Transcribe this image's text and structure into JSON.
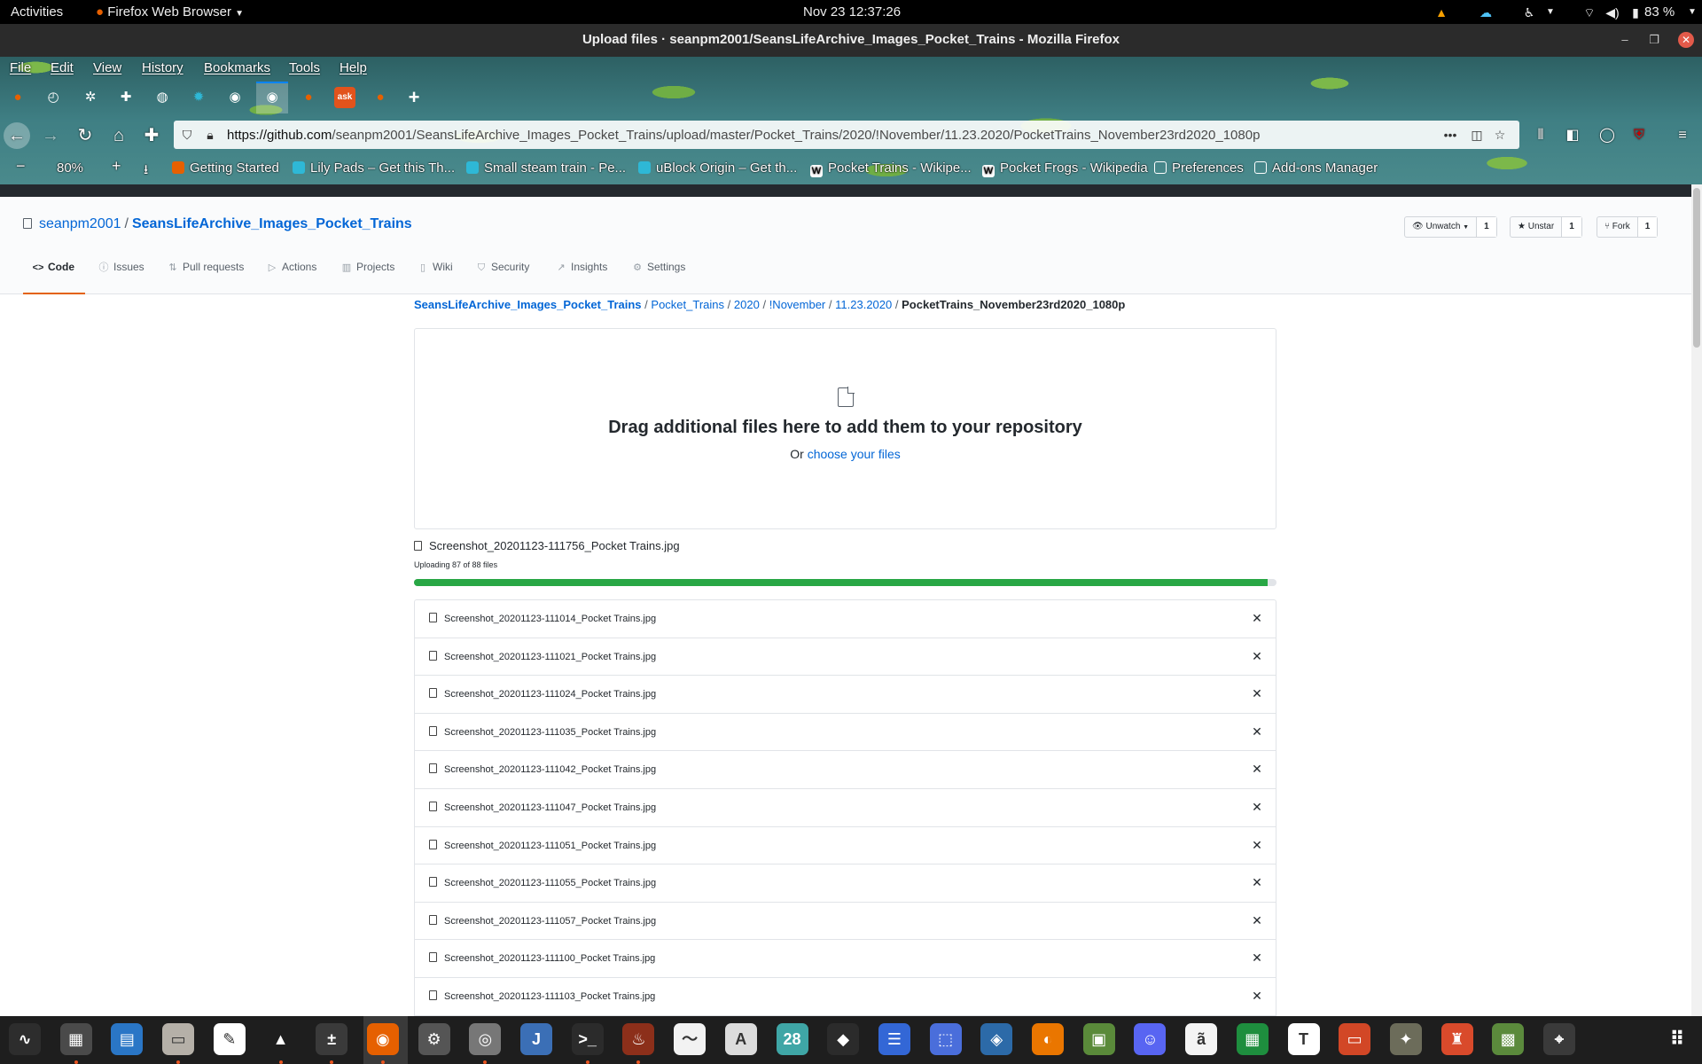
{
  "topbar": {
    "activities": "Activities",
    "app_menu": "Firefox Web Browser",
    "clock": "Nov 23  12:37:26",
    "battery": "83 %"
  },
  "window": {
    "title": "Upload files · seanpm2001/SeansLifeArchive_Images_Pocket_Trains - Mozilla Firefox"
  },
  "menu": [
    "File",
    "Edit",
    "View",
    "History",
    "Bookmarks",
    "Tools",
    "Help"
  ],
  "tabs": [
    {
      "icon": "firefox-icon",
      "color": "#e66000"
    },
    {
      "icon": "speedometer-icon",
      "color": "#ffffff"
    },
    {
      "icon": "gear-icon",
      "color": "#ffffff"
    },
    {
      "icon": "puzzle-icon",
      "color": "#ffffff"
    },
    {
      "icon": "globe-icon",
      "color": "#ffffff"
    },
    {
      "icon": "ublock-icon",
      "color": "#2eb8d6"
    },
    {
      "icon": "github-icon",
      "color": "#ffffff"
    },
    {
      "icon": "github-icon",
      "color": "#ffffff"
    },
    {
      "icon": "firefox-icon",
      "color": "#e66000"
    },
    {
      "icon": "ask-icon",
      "color": "#e2531c"
    },
    {
      "icon": "firefox-icon",
      "color": "#e66000"
    }
  ],
  "urlbar": {
    "url_host": "https://github.com",
    "url_path": "/seanpm2001/SeansLifeArchive_Images_Pocket_Trains/upload/master/Pocket_Trains/2020/!November/11.23.2020/PocketTrains_November23rd2020_1080p"
  },
  "zoom": "80%",
  "bookmarks": [
    {
      "label": "Getting Started",
      "icon": "firefox-icon"
    },
    {
      "label": "Lily Pads – Get this Th...",
      "icon": "theme-icon"
    },
    {
      "label": "Small steam train - Pe...",
      "icon": "theme-icon"
    },
    {
      "label": "uBlock Origin – Get th...",
      "icon": "ublock-icon"
    },
    {
      "label": "Pocket Trains - Wikipe...",
      "icon": "wikipedia-icon"
    },
    {
      "label": "Pocket Frogs - Wikipedia",
      "icon": "wikipedia-icon"
    },
    {
      "label": "Preferences",
      "icon": "globe-icon"
    },
    {
      "label": "Add-ons Manager",
      "icon": "globe-icon"
    }
  ],
  "repo": {
    "owner": "seanpm2001",
    "separator": "/",
    "name": "SeansLifeArchive_Images_Pocket_Trains",
    "unwatch": {
      "label": "Unwatch",
      "count": "1"
    },
    "unstar": {
      "label": "Unstar",
      "count": "1"
    },
    "fork": {
      "label": "Fork",
      "count": "1"
    },
    "tabs": [
      "Code",
      "Issues",
      "Pull requests",
      "Actions",
      "Projects",
      "Wiki",
      "Security",
      "Insights",
      "Settings"
    ]
  },
  "breadcrumb": {
    "root": "SeansLifeArchive_Images_Pocket_Trains",
    "parts": [
      "Pocket_Trains",
      "2020",
      "!November",
      "11.23.2020"
    ],
    "current": "PocketTrains_November23rd2020_1080p",
    "sep": "/"
  },
  "dropzone": {
    "heading": "Drag additional files here to add them to your repository",
    "or_text": "Or",
    "choose_link": "choose your files"
  },
  "upload": {
    "current_file": "Screenshot_20201123-111756_Pocket Trains.jpg",
    "status": "Uploading 87 of 88 files",
    "progress": 0.99
  },
  "files": [
    "Screenshot_20201123-111014_Pocket Trains.jpg",
    "Screenshot_20201123-111021_Pocket Trains.jpg",
    "Screenshot_20201123-111024_Pocket Trains.jpg",
    "Screenshot_20201123-111035_Pocket Trains.jpg",
    "Screenshot_20201123-111042_Pocket Trains.jpg",
    "Screenshot_20201123-111047_Pocket Trains.jpg",
    "Screenshot_20201123-111051_Pocket Trains.jpg",
    "Screenshot_20201123-111055_Pocket Trains.jpg",
    "Screenshot_20201123-111057_Pocket Trains.jpg",
    "Screenshot_20201123-111100_Pocket Trains.jpg",
    "Screenshot_20201123-111103_Pocket Trains.jpg"
  ],
  "dock": [
    {
      "name": "system-monitor-icon",
      "bg": "#2d2d2d",
      "glyph": "∿"
    },
    {
      "name": "gnome-blocks-icon",
      "bg": "#4a4a4a",
      "glyph": "▦"
    },
    {
      "name": "writer-icon",
      "bg": "#2a76c6",
      "glyph": "▤"
    },
    {
      "name": "files-icon",
      "bg": "#b5b0a8",
      "glyph": "▭"
    },
    {
      "name": "text-editor-icon",
      "bg": "#ffffff",
      "glyph": "✎"
    },
    {
      "name": "vlc-icon",
      "bg": "#1e1e1e",
      "glyph": "▲"
    },
    {
      "name": "calculator-icon",
      "bg": "#3a3a3a",
      "glyph": "±"
    },
    {
      "name": "firefox-icon",
      "bg": "#e66000",
      "glyph": "◉"
    },
    {
      "name": "settings-icon",
      "bg": "#555555",
      "glyph": "⚙"
    },
    {
      "name": "image-viewer-icon",
      "bg": "#777777",
      "glyph": "◎"
    },
    {
      "name": "pycharm-icon",
      "bg": "#3b6fb6",
      "glyph": "J"
    },
    {
      "name": "terminal-icon",
      "bg": "#2b2b2b",
      "glyph": ">_"
    },
    {
      "name": "game-icon",
      "bg": "#8c2f1a",
      "glyph": "♨"
    },
    {
      "name": "audio-editor-icon",
      "bg": "#f2f2f2",
      "glyph": "〜"
    },
    {
      "name": "app-store-icon",
      "bg": "#dcdcdc",
      "glyph": "A"
    },
    {
      "name": "calendar-icon",
      "bg": "#3fa6a6",
      "glyph": "28"
    },
    {
      "name": "inkscape-icon",
      "bg": "#2b2b2b",
      "glyph": "◆"
    },
    {
      "name": "tasks-icon",
      "bg": "#3367d6",
      "glyph": "☰"
    },
    {
      "name": "screenshot-icon",
      "bg": "#4a6edb",
      "glyph": "⬚"
    },
    {
      "name": "virtualbox-icon",
      "bg": "#2c6aa8",
      "glyph": "◈"
    },
    {
      "name": "blender-icon",
      "bg": "#ea7600",
      "glyph": "◐"
    },
    {
      "name": "photo-editor-icon",
      "bg": "#5a8a3a",
      "glyph": "▣"
    },
    {
      "name": "discord-icon",
      "bg": "#5865f2",
      "glyph": "☺"
    },
    {
      "name": "document-icon",
      "bg": "#f4f4f4",
      "glyph": "ã"
    },
    {
      "name": "spreadsheet-icon",
      "bg": "#1e8e3e",
      "glyph": "▦"
    },
    {
      "name": "typora-icon",
      "bg": "#ffffff",
      "glyph": "T"
    },
    {
      "name": "presentation-icon",
      "bg": "#d24726",
      "glyph": "▭"
    },
    {
      "name": "gimp-icon",
      "bg": "#6c6c5a",
      "glyph": "✦"
    },
    {
      "name": "mario-icon",
      "bg": "#d94a2b",
      "glyph": "♜"
    },
    {
      "name": "minecraft-icon",
      "bg": "#5b8a3c",
      "glyph": "▩"
    },
    {
      "name": "maps-icon",
      "bg": "#3a3a3a",
      "glyph": "⌖"
    }
  ]
}
